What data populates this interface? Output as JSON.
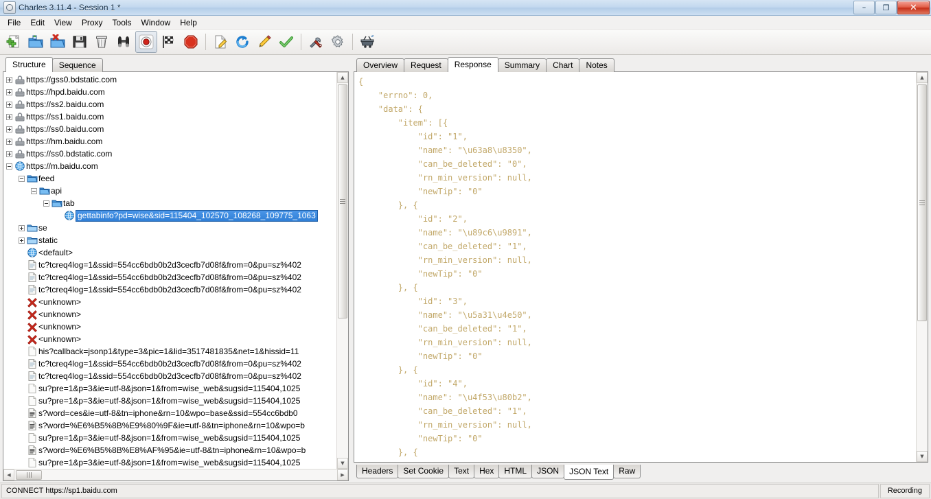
{
  "window": {
    "title": "Charles 3.11.4 - Session 1 *",
    "app_icon": "charles-app-icon",
    "minimize_label": "–",
    "restore_label": "❐",
    "close_label": "✕"
  },
  "menu": {
    "items": [
      {
        "label": "File",
        "name": "menu-file"
      },
      {
        "label": "Edit",
        "name": "menu-edit"
      },
      {
        "label": "View",
        "name": "menu-view"
      },
      {
        "label": "Proxy",
        "name": "menu-proxy"
      },
      {
        "label": "Tools",
        "name": "menu-tools"
      },
      {
        "label": "Window",
        "name": "menu-window"
      },
      {
        "label": "Help",
        "name": "menu-help"
      }
    ]
  },
  "toolbar": {
    "buttons": [
      {
        "icon": "new-session-icon",
        "title": "New"
      },
      {
        "icon": "open-folder-icon",
        "title": "Open"
      },
      {
        "icon": "close-folder-icon",
        "title": "Close"
      },
      {
        "icon": "save-floppy-icon",
        "title": "Save"
      },
      {
        "icon": "trash-icon",
        "title": "Clear Session"
      },
      {
        "icon": "binoculars-icon",
        "title": "Find"
      },
      {
        "icon": "record-icon",
        "title": "Start Recording",
        "pressed": true
      },
      {
        "icon": "checkered-flag-icon",
        "title": "Start Sequence"
      },
      {
        "icon": "stop-octagon-icon",
        "title": "Stop"
      },
      {
        "separator": true
      },
      {
        "icon": "compose-note-icon",
        "title": "Compose"
      },
      {
        "icon": "repeat-refresh-icon",
        "title": "Repeat"
      },
      {
        "icon": "pencil-edit-icon",
        "title": "Edit"
      },
      {
        "icon": "validate-check-icon",
        "title": "Validate"
      },
      {
        "separator": true
      },
      {
        "icon": "tools-wrench-icon",
        "title": "Tools"
      },
      {
        "icon": "gear-settings-icon",
        "title": "Settings"
      },
      {
        "separator": true
      },
      {
        "icon": "basket-icon",
        "title": "Throttle"
      }
    ]
  },
  "left_pane": {
    "tabs": [
      {
        "label": "Structure",
        "active": true
      },
      {
        "label": "Sequence",
        "active": false
      }
    ],
    "tree": [
      {
        "level": 0,
        "expander": "plus",
        "icon": "secure-server-icon",
        "label": "https://gss0.bdstatic.com"
      },
      {
        "level": 0,
        "expander": "plus",
        "icon": "secure-server-icon",
        "label": "https://hpd.baidu.com"
      },
      {
        "level": 0,
        "expander": "plus",
        "icon": "secure-server-icon",
        "label": "https://ss2.baidu.com"
      },
      {
        "level": 0,
        "expander": "plus",
        "icon": "secure-server-icon",
        "label": "https://ss1.baidu.com"
      },
      {
        "level": 0,
        "expander": "plus",
        "icon": "secure-server-icon",
        "label": "https://ss0.baidu.com"
      },
      {
        "level": 0,
        "expander": "plus",
        "icon": "secure-server-icon",
        "label": "https://hm.baidu.com"
      },
      {
        "level": 0,
        "expander": "plus",
        "icon": "secure-server-icon",
        "label": "https://ss0.bdstatic.com"
      },
      {
        "level": 0,
        "expander": "minus",
        "icon": "globe-icon",
        "label": "https://m.baidu.com"
      },
      {
        "level": 1,
        "expander": "minus",
        "icon": "folder-open-icon",
        "label": "feed"
      },
      {
        "level": 2,
        "expander": "minus",
        "icon": "folder-open-icon",
        "label": "api"
      },
      {
        "level": 3,
        "expander": "minus",
        "icon": "folder-open-icon",
        "label": "tab"
      },
      {
        "level": 4,
        "expander": "none",
        "icon": "globe-icon",
        "label": "gettabinfo?pd=wise&sid=115404_102570_108268_109775_1063",
        "selected": true
      },
      {
        "level": 1,
        "expander": "plus",
        "icon": "folder-closed-icon",
        "label": "se"
      },
      {
        "level": 1,
        "expander": "plus",
        "icon": "folder-closed-icon",
        "label": "static"
      },
      {
        "level": 1,
        "expander": "none",
        "icon": "globe-icon",
        "label": "<default>"
      },
      {
        "level": 1,
        "expander": "none",
        "icon": "document-icon",
        "label": "tc?tcreq4log=1&ssid=554cc6bdb0b2d3cecfb7d08f&from=0&pu=sz%402"
      },
      {
        "level": 1,
        "expander": "none",
        "icon": "document-icon",
        "label": "tc?tcreq4log=1&ssid=554cc6bdb0b2d3cecfb7d08f&from=0&pu=sz%402"
      },
      {
        "level": 1,
        "expander": "none",
        "icon": "document-icon",
        "label": "tc?tcreq4log=1&ssid=554cc6bdb0b2d3cecfb7d08f&from=0&pu=sz%402"
      },
      {
        "level": 1,
        "expander": "none",
        "icon": "error-x-icon",
        "label": "<unknown>"
      },
      {
        "level": 1,
        "expander": "none",
        "icon": "error-x-icon",
        "label": "<unknown>"
      },
      {
        "level": 1,
        "expander": "none",
        "icon": "error-x-icon",
        "label": "<unknown>"
      },
      {
        "level": 1,
        "expander": "none",
        "icon": "error-x-icon",
        "label": "<unknown>"
      },
      {
        "level": 1,
        "expander": "none",
        "icon": "document-plain-icon",
        "label": "his?callback=jsonp1&type=3&pic=1&lid=3517481835&net=1&hissid=11"
      },
      {
        "level": 1,
        "expander": "none",
        "icon": "document-icon",
        "label": "tc?tcreq4log=1&ssid=554cc6bdb0b2d3cecfb7d08f&from=0&pu=sz%402"
      },
      {
        "level": 1,
        "expander": "none",
        "icon": "document-icon",
        "label": "tc?tcreq4log=1&ssid=554cc6bdb0b2d3cecfb7d08f&from=0&pu=sz%402"
      },
      {
        "level": 1,
        "expander": "none",
        "icon": "document-plain-icon",
        "label": "su?pre=1&p=3&ie=utf-8&json=1&from=wise_web&sugsid=115404,1025"
      },
      {
        "level": 1,
        "expander": "none",
        "icon": "document-plain-icon",
        "label": "su?pre=1&p=3&ie=utf-8&json=1&from=wise_web&sugsid=115404,1025"
      },
      {
        "level": 1,
        "expander": "none",
        "icon": "page-lines-icon",
        "label": "s?word=ces&ie=utf-8&tn=iphone&rn=10&wpo=base&ssid=554cc6bdb0"
      },
      {
        "level": 1,
        "expander": "none",
        "icon": "page-lines-icon",
        "label": "s?word=%E6%B5%8B%E9%80%9F&ie=utf-8&tn=iphone&rn=10&wpo=b"
      },
      {
        "level": 1,
        "expander": "none",
        "icon": "document-plain-icon",
        "label": "su?pre=1&p=3&ie=utf-8&json=1&from=wise_web&sugsid=115404,1025"
      },
      {
        "level": 1,
        "expander": "none",
        "icon": "page-lines-icon",
        "label": "s?word=%E6%B5%8B%E8%AF%95&ie=utf-8&tn=iphone&rn=10&wpo=b"
      },
      {
        "level": 1,
        "expander": "none",
        "icon": "document-plain-icon",
        "label": "su?pre=1&p=3&ie=utf-8&json=1&from=wise_web&sugsid=115404,1025"
      }
    ]
  },
  "right_pane": {
    "tabs": [
      {
        "label": "Overview",
        "active": false
      },
      {
        "label": "Request",
        "active": false
      },
      {
        "label": "Response",
        "active": true
      },
      {
        "label": "Summary",
        "active": false
      },
      {
        "label": "Chart",
        "active": false
      },
      {
        "label": "Notes",
        "active": false
      }
    ],
    "body_tabs": [
      {
        "label": "Headers",
        "active": false
      },
      {
        "label": "Set Cookie",
        "active": false
      },
      {
        "label": "Text",
        "active": false
      },
      {
        "label": "Hex",
        "active": false
      },
      {
        "label": "HTML",
        "active": false
      },
      {
        "label": "JSON",
        "active": false
      },
      {
        "label": "JSON Text",
        "active": true
      },
      {
        "label": "Raw",
        "active": false
      }
    ],
    "json_text": [
      "{",
      "    \"errno\": 0,",
      "    \"data\": {",
      "        \"item\": [{",
      "            \"id\": \"1\",",
      "            \"name\": \"\\u63a8\\u8350\",",
      "            \"can_be_deleted\": \"0\",",
      "            \"rn_min_version\": null,",
      "            \"newTip\": \"0\"",
      "        }, {",
      "            \"id\": \"2\",",
      "            \"name\": \"\\u89c6\\u9891\",",
      "            \"can_be_deleted\": \"1\",",
      "            \"rn_min_version\": null,",
      "            \"newTip\": \"0\"",
      "        }, {",
      "            \"id\": \"3\",",
      "            \"name\": \"\\u5a31\\u4e50\",",
      "            \"can_be_deleted\": \"1\",",
      "            \"rn_min_version\": null,",
      "            \"newTip\": \"0\"",
      "        }, {",
      "            \"id\": \"4\",",
      "            \"name\": \"\\u4f53\\u80b2\",",
      "            \"can_be_deleted\": \"1\",",
      "            \"rn_min_version\": null,",
      "            \"newTip\": \"0\"",
      "        }, {"
    ]
  },
  "status_bar": {
    "left": "CONNECT https://sp1.baidu.com",
    "right": "Recording"
  },
  "colors": {
    "json_text": "#c2a869",
    "selection": "#2f7fd6",
    "title_gradient_top": "#d6e5f4"
  }
}
